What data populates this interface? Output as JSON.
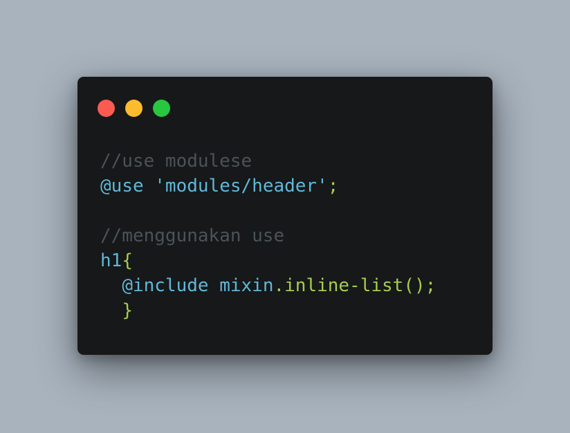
{
  "colors": {
    "background": "#a8b3be",
    "window": "#171819",
    "dot_red": "#fd5a52",
    "dot_yellow": "#fdbb2e",
    "dot_green": "#27c73f",
    "comment": "#4a5358",
    "keyword": "#5fb8d8",
    "punctuation": "#a6cc51"
  },
  "window_controls": [
    {
      "name": "close",
      "icon": "close-dot-icon"
    },
    {
      "name": "minimize",
      "icon": "minimize-dot-icon"
    },
    {
      "name": "maximize",
      "icon": "maximize-dot-icon"
    }
  ],
  "code": {
    "line1": {
      "comment": "//use modulese"
    },
    "line2": {
      "at_rule": "@use",
      "space": " ",
      "string": "'modules/header'",
      "semicolon": ";"
    },
    "line3": {
      "text": ""
    },
    "line4": {
      "comment": "//menggunakan use"
    },
    "line5": {
      "selector": "h1",
      "brace_open": "{"
    },
    "line6": {
      "indent": "  ",
      "at_rule": "@include",
      "space": " ",
      "module": "mixin",
      "dot": ".",
      "function": "inline-list",
      "call": "();"
    },
    "line7": {
      "indent": "  ",
      "brace_close": "}"
    }
  }
}
